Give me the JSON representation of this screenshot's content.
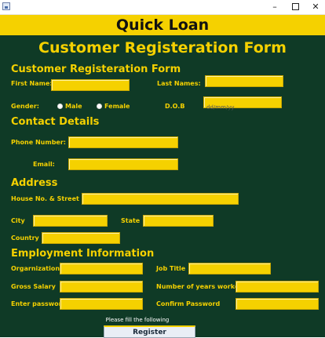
{
  "window": {
    "minimize_glyph": "–",
    "close_glyph": "✕"
  },
  "header": {
    "app_title": "Quick Loan"
  },
  "form": {
    "title": "Customer Registeration Form",
    "sections": {
      "customer": "Customer Registeration Form",
      "contact": "Contact Details",
      "address": "Address",
      "employment": "Employment Information"
    },
    "labels": {
      "first_name": "First Name:",
      "last_name": "Last Names:",
      "gender": "Gender:",
      "dob": "D.O.B",
      "phone": "Phone Number:",
      "email": "Email:",
      "house": "House No. & Street",
      "city": "City",
      "state": "State",
      "country": "Country",
      "organization": "Orgarnization",
      "job_title": "Job Title",
      "gross_salary": "Gross Salary",
      "years_worked": "Number of years worked",
      "enter_password": "Enter password",
      "confirm_password": "Confirm Password"
    },
    "gender_options": {
      "male": "Male",
      "female": "Female"
    },
    "placeholders": {
      "dob": "dd/mm/yy"
    },
    "values": {
      "first_name": "",
      "last_name": "",
      "dob": "",
      "phone": "",
      "email": "",
      "house": "",
      "city": "",
      "state": "",
      "country": "",
      "organization": "",
      "job_title": "",
      "gross_salary": "",
      "years_worked": "",
      "enter_password": "",
      "confirm_password": ""
    },
    "hint": "Please fill the following",
    "register_label": "Register"
  }
}
